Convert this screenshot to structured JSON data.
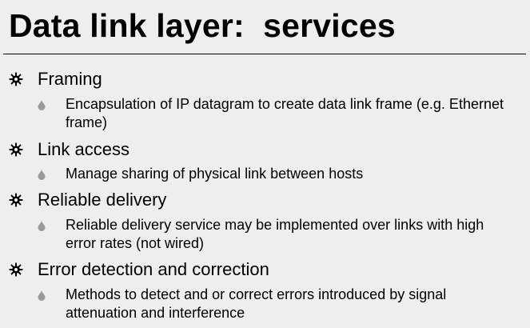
{
  "slide": {
    "title": "Data link layer:  services",
    "items": [
      {
        "heading": "Framing",
        "detail": "Encapsulation of IP datagram to create data link frame  (e.g. Ethernet frame)"
      },
      {
        "heading": "Link access",
        "detail": "Manage sharing of physical link between hosts"
      },
      {
        "heading": "Reliable delivery",
        "detail": "Reliable delivery service may be implemented over links with high error rates (not wired)"
      },
      {
        "heading": "Error detection and correction",
        "detail": "Methods to detect and or correct errors introduced by signal attenuation and interference"
      }
    ],
    "bullet_icon": "wheel-bullet",
    "sub_bullet_icon": "drop-bullet",
    "colors": {
      "background": "#eeeeee",
      "text": "#000000",
      "sub_bullet": "#9a9a9a"
    }
  }
}
